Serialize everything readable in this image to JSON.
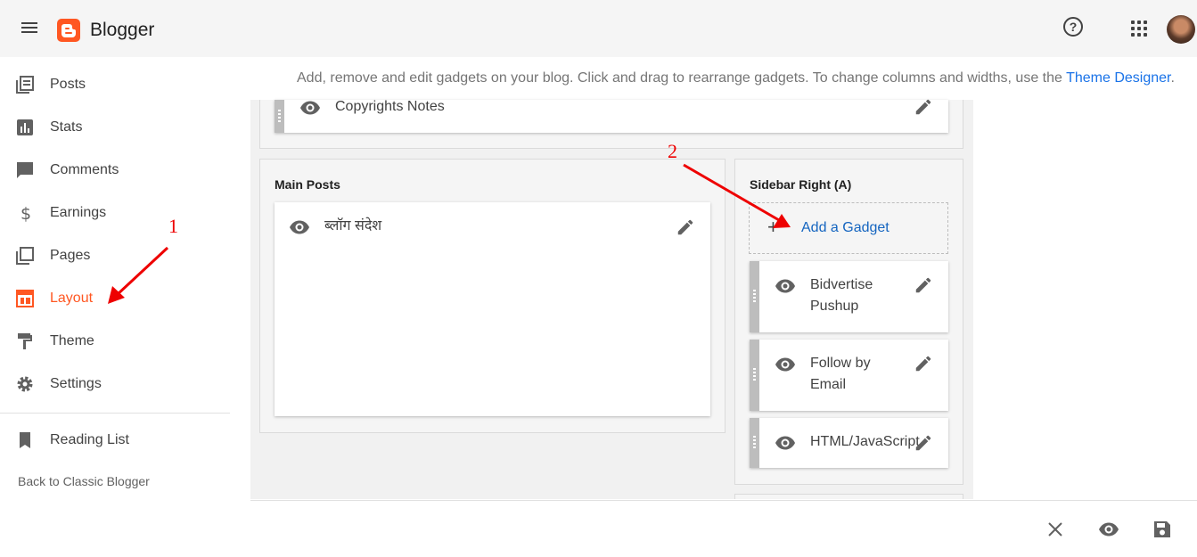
{
  "app": {
    "title": "Blogger"
  },
  "nav": {
    "items": [
      {
        "label": "Posts",
        "icon": "posts-icon"
      },
      {
        "label": "Stats",
        "icon": "stats-icon"
      },
      {
        "label": "Comments",
        "icon": "comments-icon"
      },
      {
        "label": "Earnings",
        "icon": "dollar-icon"
      },
      {
        "label": "Pages",
        "icon": "pages-icon"
      },
      {
        "label": "Layout",
        "icon": "layout-icon",
        "active": true
      },
      {
        "label": "Theme",
        "icon": "paint-roller-icon"
      },
      {
        "label": "Settings",
        "icon": "gear-icon"
      }
    ],
    "reading_list": "Reading List",
    "classic": "Back to Classic Blogger"
  },
  "main": {
    "help_prefix": "Add, remove and edit gadgets on your blog. Click and drag to rearrange gadgets. To change columns and widths, use the ",
    "help_link": "Theme Designer",
    "help_suffix": ".",
    "top_gadget": "Copyrights Notes",
    "main_posts": {
      "title": "Main Posts",
      "gadget": "ब्लॉग संदेश"
    },
    "sidebar": {
      "title": "Sidebar Right (A)",
      "add_gadget": "Add a Gadget",
      "gadgets": [
        {
          "line1": "Bidvertise",
          "line2": "Pushup"
        },
        {
          "line1": "Follow by",
          "line2": "Email"
        },
        {
          "line1": "HTML/JavaScript",
          "line2": ""
        }
      ]
    }
  },
  "annotations": {
    "one": "1",
    "two": "2"
  },
  "colors": {
    "accent": "#ff5722",
    "link": "#1a73e8",
    "annotation": "#ee0000"
  }
}
